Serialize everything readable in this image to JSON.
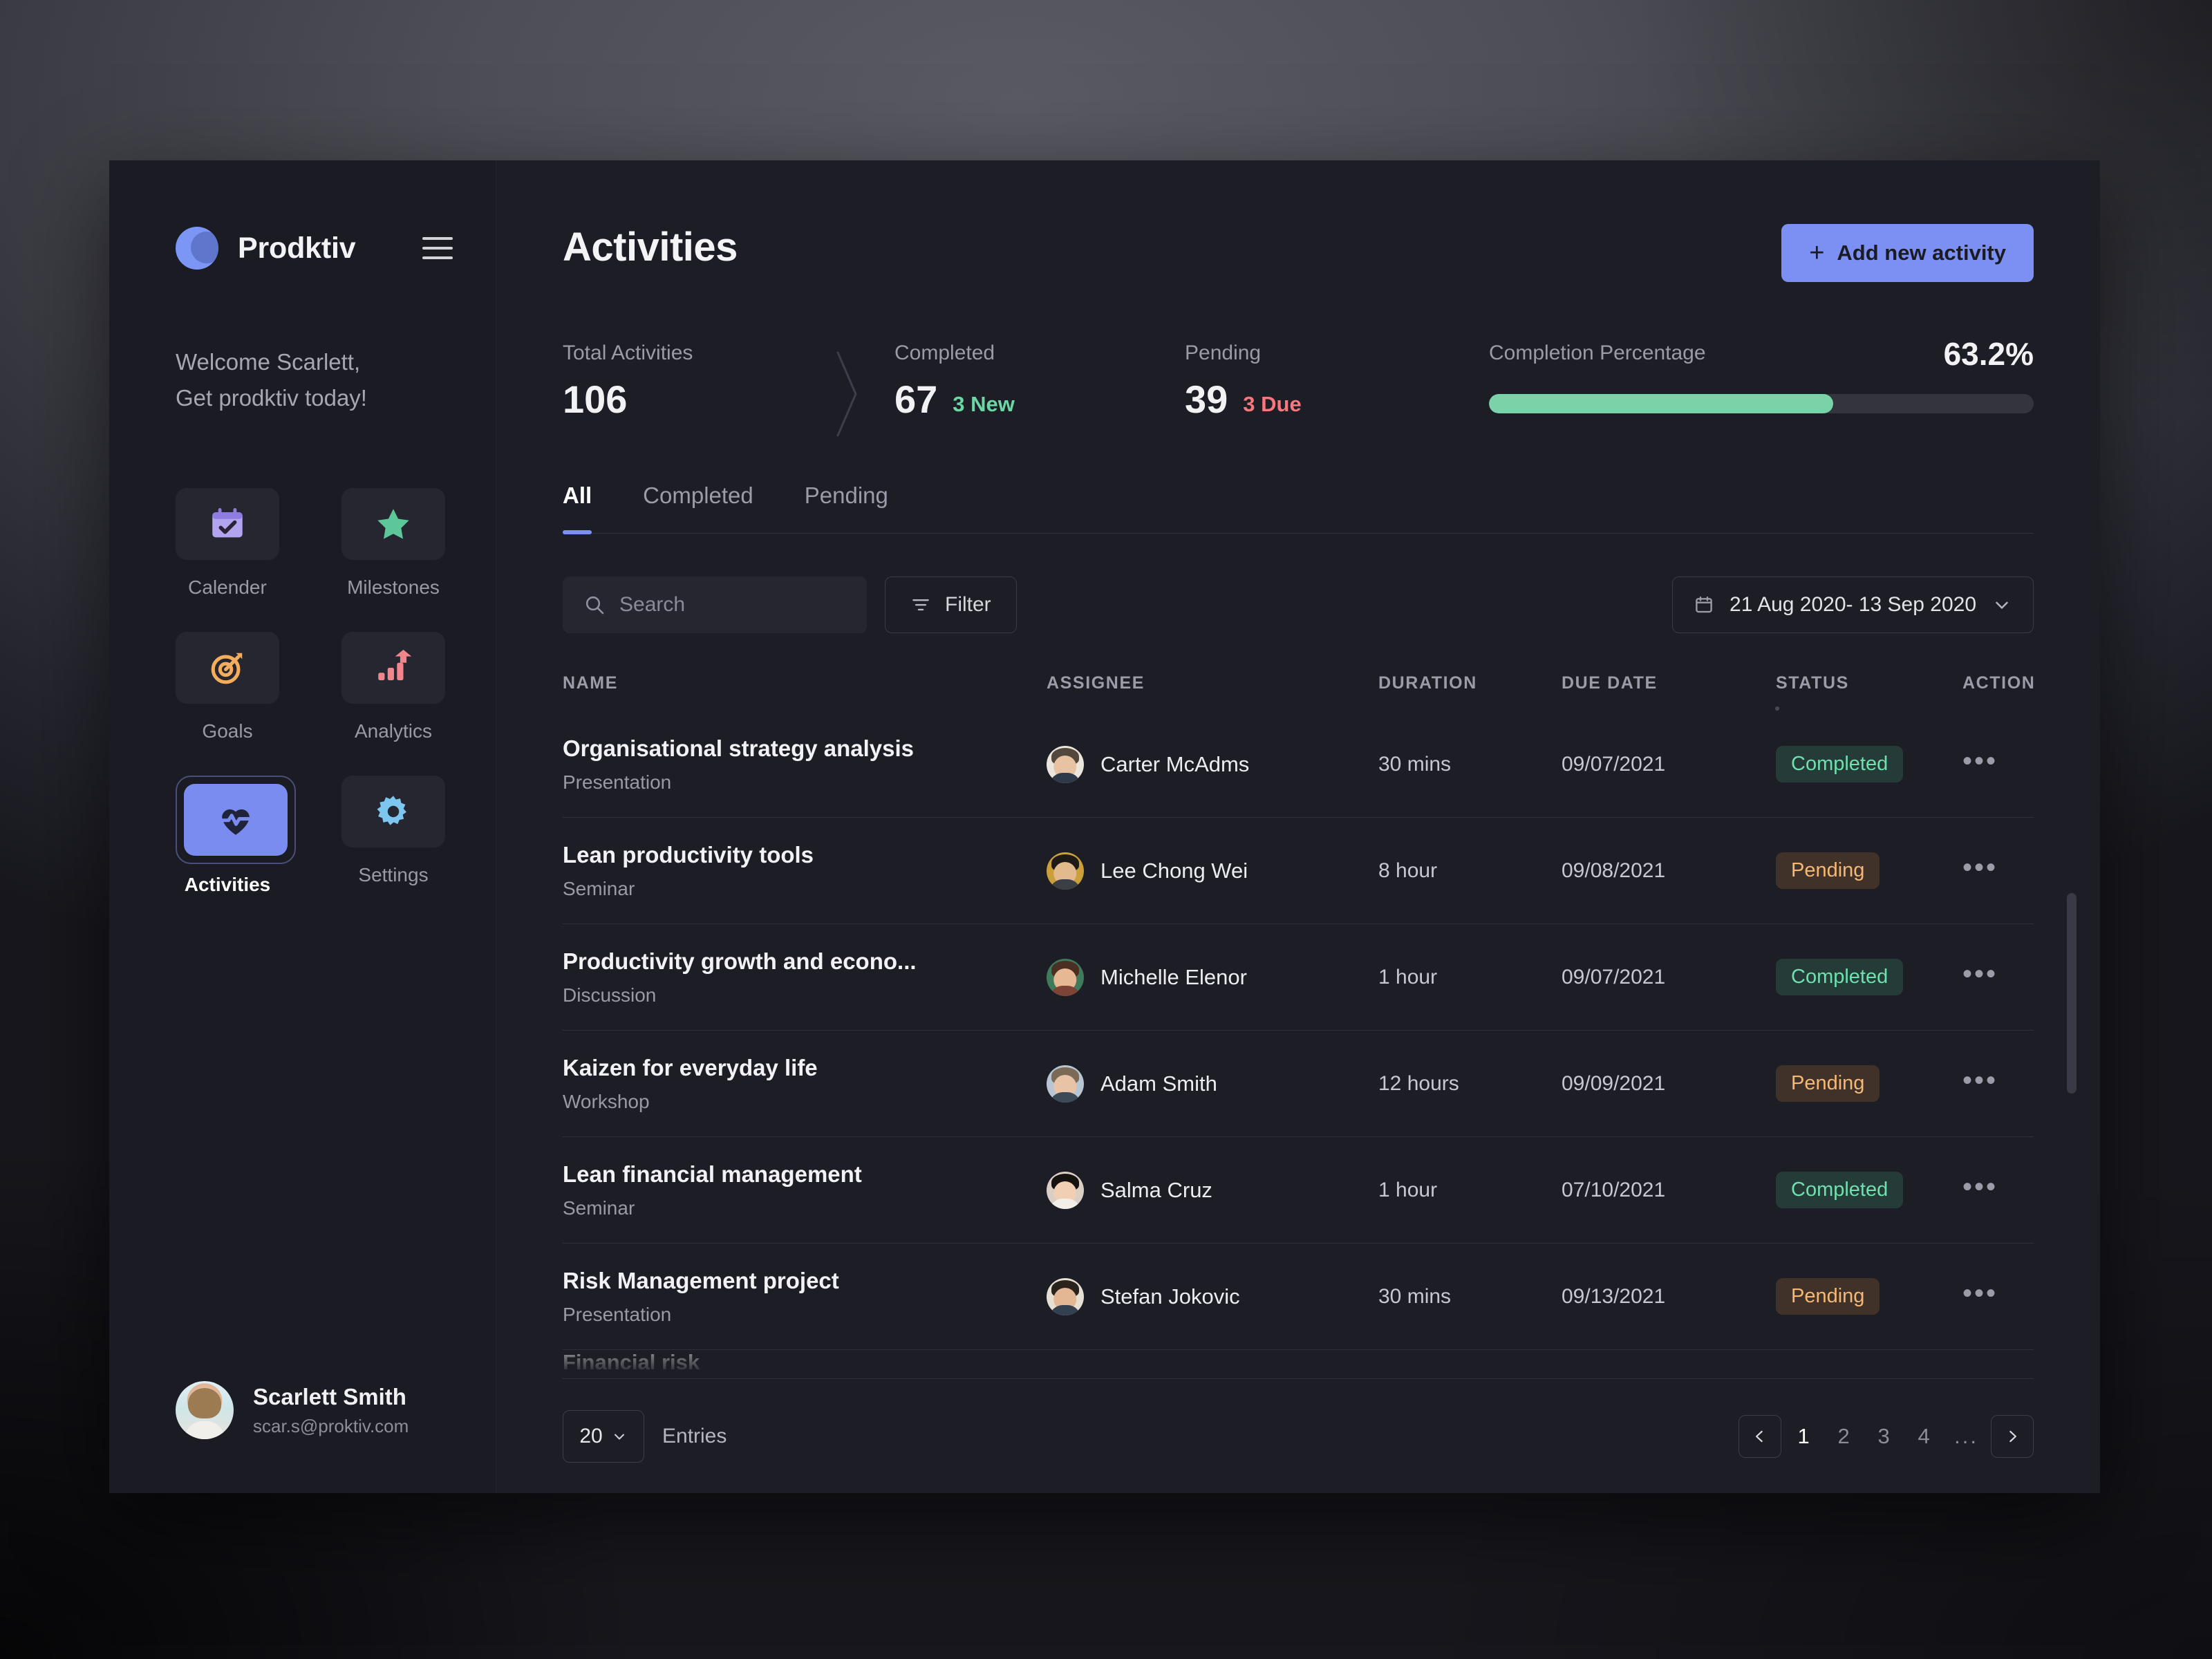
{
  "brand": {
    "name": "Prodktiv",
    "menu_icon": "hamburger-icon"
  },
  "welcome": {
    "line1": "Welcome Scarlett,",
    "line2": "Get prodktiv today!"
  },
  "sidebar": {
    "items": [
      {
        "label": "Calender",
        "icon": "calendar-check-icon",
        "active": false
      },
      {
        "label": "Milestones",
        "icon": "star-icon",
        "active": false
      },
      {
        "label": "Goals",
        "icon": "target-icon",
        "active": false
      },
      {
        "label": "Analytics",
        "icon": "bar-chart-icon",
        "active": false
      },
      {
        "label": "Activities",
        "icon": "heartbeat-icon",
        "active": true
      },
      {
        "label": "Settings",
        "icon": "gear-icon",
        "active": false
      }
    ]
  },
  "profile": {
    "name": "Scarlett Smith",
    "email": "scar.s@proktiv.com"
  },
  "header": {
    "title": "Activities",
    "add_button": "Add new activity"
  },
  "stats": {
    "total": {
      "label": "Total Activities",
      "value": "106"
    },
    "completed": {
      "label": "Completed",
      "value": "67",
      "sub": "3 New",
      "sub_color": "#6cd6a5"
    },
    "pending": {
      "label": "Pending",
      "value": "39",
      "sub": "3 Due",
      "sub_color": "#f4787e"
    },
    "completion": {
      "label": "Completion Percentage",
      "value": "63.2%",
      "percent": 63.2,
      "bar_color": "#7ad3a8"
    }
  },
  "tabs": [
    {
      "label": "All",
      "active": true
    },
    {
      "label": "Completed",
      "active": false
    },
    {
      "label": "Pending",
      "active": false
    }
  ],
  "toolbar": {
    "search_placeholder": "Search",
    "search_value": "",
    "filter_label": "Filter",
    "date_range": "21 Aug 2020-  13 Sep 2020"
  },
  "table": {
    "columns": [
      "NAME",
      "ASSIGNEE",
      "DURATION",
      "DUE DATE",
      "STATUS",
      "ACTION"
    ],
    "rows": [
      {
        "name": "Organisational strategy analysis",
        "type": "Presentation",
        "assignee": "Carter McAdms",
        "duration": "30 mins",
        "due": "09/07/2021",
        "status": "Completed",
        "av_bg": "#eae6dd",
        "av_hair": "#54473c",
        "av_face": "#e7c3a4",
        "av_body": "#2e3a4a"
      },
      {
        "name": "Lean productivity tools",
        "type": "Seminar",
        "assignee": "Lee Chong Wei",
        "duration": "8 hour",
        "due": "09/08/2021",
        "status": "Pending",
        "av_bg": "#caa03a",
        "av_hair": "#1e1a16",
        "av_face": "#e3b98e",
        "av_body": "#3a3f46"
      },
      {
        "name": "Productivity growth and  econo...",
        "type": "Discussion",
        "assignee": "Michelle Elenor",
        "duration": "1 hour",
        "due": "09/07/2021",
        "status": "Completed",
        "av_bg": "#3f7a5a",
        "av_hair": "#4a2f22",
        "av_face": "#e6b894",
        "av_body": "#7d4436"
      },
      {
        "name": "Kaizen for everyday life",
        "type": "Workshop",
        "assignee": "Adam Smith",
        "duration": "12 hours",
        "due": "09/09/2021",
        "status": "Pending",
        "av_bg": "#b8c6d4",
        "av_hair": "#7b6a55",
        "av_face": "#e8c3a6",
        "av_body": "#3c4a58"
      },
      {
        "name": "Lean financial management",
        "type": "Seminar",
        "assignee": "Salma Cruz",
        "duration": "1 hour",
        "due": "07/10/2021",
        "status": "Completed",
        "av_bg": "#d9cfc4",
        "av_hair": "#16120f",
        "av_face": "#f0cfb5",
        "av_body": "#f2efe9"
      },
      {
        "name": "Risk Management project",
        "type": "Presentation",
        "assignee": "Stefan Jokovic",
        "duration": "30 mins",
        "due": "09/13/2021",
        "status": "Pending",
        "av_bg": "#e6dfd3",
        "av_hair": "#2a231c",
        "av_face": "#e3b694",
        "av_body": "#33404f"
      }
    ],
    "action_icon": "more-horizontal-icon"
  },
  "footer": {
    "entries_value": "20",
    "entries_label": "Entries",
    "pages": [
      "1",
      "2",
      "3",
      "4"
    ],
    "ellipsis": "...",
    "current_page": "1",
    "prev_icon": "chevron-left-icon",
    "next_icon": "chevron-right-icon"
  }
}
